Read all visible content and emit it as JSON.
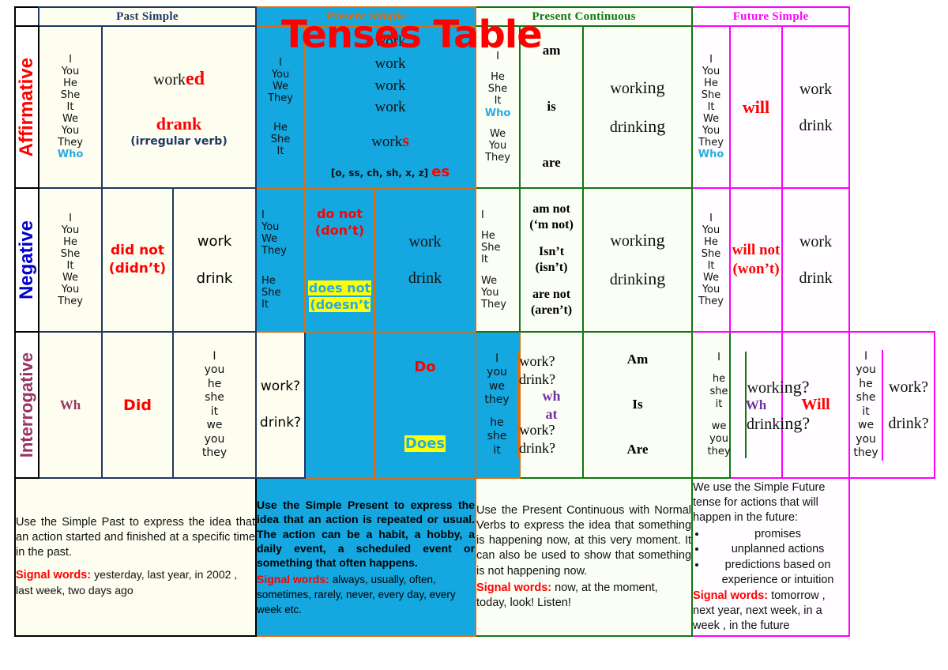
{
  "title": "Tenses Table",
  "colors": {
    "past": "#1f3864",
    "present_simple": "#e36c0a",
    "present_simple_bg": "#14a7e0",
    "present_continuous": "#117711",
    "future": "#ff00ff",
    "title": "#ff0000",
    "affirmative_label": "#ff0000",
    "negative_label": "#0000cc",
    "interrogative_label": "#993366",
    "highlight": "#ffff00"
  },
  "corner_header": "",
  "columns": [
    {
      "id": "past",
      "header": "Past Simple"
    },
    {
      "id": "present_simple",
      "header": "Present Simple"
    },
    {
      "id": "present_continuous",
      "header": "Present Continuous"
    },
    {
      "id": "future_simple",
      "header": "Future Simple"
    }
  ],
  "rows": [
    {
      "id": "affirmative",
      "label": "Affirmative"
    },
    {
      "id": "negative",
      "label": "Negative"
    },
    {
      "id": "interrogative",
      "label": "Interrogative"
    }
  ],
  "cells": {
    "affirmative": {
      "past": {
        "subjects": [
          "I",
          "You",
          "He",
          "She",
          "It",
          "We",
          "You",
          "They",
          "Who"
        ],
        "who": "Who",
        "verb_stem": "work",
        "verb_suffix": "ed",
        "irregular": "drank",
        "irregular_note": "(irregular verb)"
      },
      "present_simple": {
        "subjects_group1": [
          "I",
          "You",
          "We",
          "They"
        ],
        "subjects_group2": [
          "He",
          "She",
          "It"
        ],
        "verbs_group1": [
          "work",
          "work",
          "work",
          "work"
        ],
        "verb_group2_stem": "work",
        "verb_group2_suffix": "s",
        "spelling_rule": "[o, ss, ch, sh, x, z]",
        "spelling_suffix": "es"
      },
      "present_continuous": {
        "subjects_group1": [
          "I"
        ],
        "subjects_group2": [
          "He",
          "She",
          "It",
          "Who"
        ],
        "subjects_group3": [
          "We",
          "You",
          "They"
        ],
        "aux1": "am",
        "aux2": "is",
        "aux3": "are",
        "verb1_stem": "work",
        "verb1_suffix": "ing",
        "verb2_stem": "drink",
        "verb2_suffix": "ing"
      },
      "future_simple": {
        "subjects": [
          "I",
          "You",
          "He",
          "She",
          "It",
          "We",
          "You",
          "They",
          "Who"
        ],
        "who": "Who",
        "aux": "will",
        "verbs": [
          "work",
          "drink"
        ]
      }
    },
    "negative": {
      "past": {
        "subjects": [
          "I",
          "You",
          "He",
          "She",
          "It",
          "We",
          "You",
          "They"
        ],
        "aux": "did not",
        "aux_short": "(didn’t)",
        "verbs": [
          "work",
          "drink"
        ]
      },
      "present_simple": {
        "subjects_group1": [
          "I",
          "You",
          "We",
          "They"
        ],
        "subjects_group2": [
          "He",
          "She",
          "It"
        ],
        "aux1": "do not",
        "aux1_short": "(don’t)",
        "aux2": "does not",
        "aux2_short": "(doesn’t",
        "verbs": [
          "work",
          "drink"
        ]
      },
      "present_continuous": {
        "subjects_group1": [
          "I"
        ],
        "subjects_group2": [
          "He",
          "She",
          "It"
        ],
        "subjects_group3": [
          "We",
          "You",
          "They"
        ],
        "aux1": "am not",
        "aux1_short": "(‘m not)",
        "aux2": "Isn’t",
        "aux2_short": "(isn’t)",
        "aux3": "are not",
        "aux3_short": "(aren’t)",
        "verb1_stem": "work",
        "verb1_suffix": "ing",
        "verb2_stem": "drink",
        "verb2_suffix": "ing"
      },
      "future_simple": {
        "subjects": [
          "I",
          "You",
          "He",
          "She",
          "It",
          "We",
          "You",
          "They"
        ],
        "aux": "will not",
        "aux_short": "(won’t)",
        "verbs": [
          "work",
          "drink"
        ]
      }
    },
    "interrogative": {
      "past": {
        "wh": "Wh",
        "aux": "Did",
        "subjects": [
          "I",
          "you",
          "he",
          "she",
          "it",
          "we",
          "you",
          "they"
        ],
        "verbs": [
          "work?",
          "drink?"
        ]
      },
      "present_simple": {
        "aux1": "Do",
        "aux2": "Does",
        "subjects_group1": [
          "I",
          "you",
          "we",
          "they"
        ],
        "subjects_group2": [
          "he",
          "she",
          "it"
        ],
        "verbs_group1": [
          "work?",
          "drink?"
        ],
        "verbs_group2": [
          "work?",
          "drink?"
        ]
      },
      "present_continuous": {
        "wh": "what",
        "aux1": "Am",
        "aux2": "Is",
        "aux3": "Are",
        "subjects_group1": [
          "I"
        ],
        "subjects_group2": [
          "he",
          "she",
          "it"
        ],
        "subjects_group3": [
          "we",
          "you",
          "they"
        ],
        "verb1_stem": "work",
        "verb1_suffix": "ing?",
        "verb2_stem": "drink",
        "verb2_suffix": "ing?"
      },
      "future_simple": {
        "wh": "Wh",
        "aux": "Will",
        "subjects": [
          "I",
          "you",
          "he",
          "she",
          "it",
          "we",
          "you",
          "they"
        ],
        "verbs": [
          "work?",
          "drink?"
        ]
      }
    }
  },
  "descriptions": {
    "past": {
      "body": "Use the Simple Past to express the idea that an action started and finished at a specific time in the past.",
      "signal_label": "Signal words:",
      "signal_words": "yesterday, last year, in 2002 , last week, two days ago"
    },
    "present_simple": {
      "body": "Use the Simple Present to express the idea that an action is repeated or usual. The action can be a habit, a hobby, a daily event, a scheduled event or something that often happens.",
      "signal_label": "Signal words:",
      "signal_words": "always,   usually, often, sometimes, rarely,   never, every day, every week etc."
    },
    "present_continuous": {
      "body": "Use the Present Continuous with Normal Verbs to express the idea that something is happening now, at this very moment. It can also be used to show that something is not happening now.",
      "signal_label": "Signal words:",
      "signal_words": "now, at the moment, today, look! Listen!"
    },
    "future_simple": {
      "body": "We use the Simple Future tense for actions that will happen in the future:",
      "bullets": [
        "promises",
        "unplanned actions",
        "predictions based on experience or intuition"
      ],
      "signal_label": "Signal words:",
      "signal_words": "tomorrow , next year, next week, in a week ,  in the future"
    }
  }
}
